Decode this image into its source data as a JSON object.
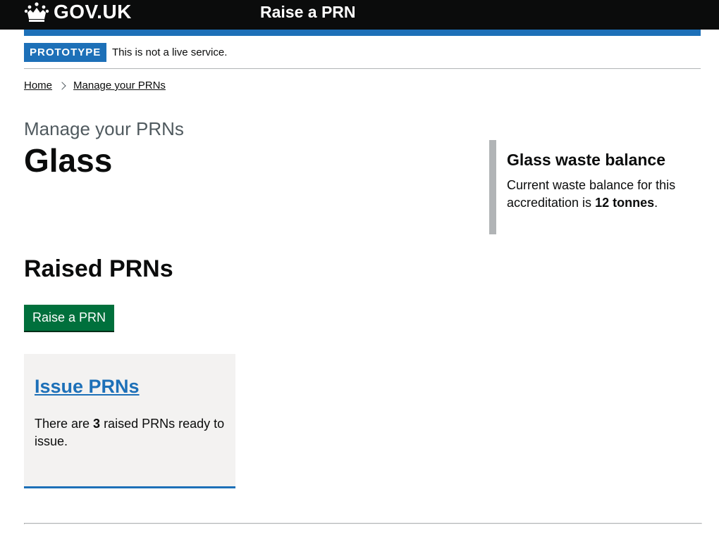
{
  "header": {
    "logo_text": "GOV.UK",
    "service_name": "Raise a PRN"
  },
  "phase_banner": {
    "tag": "PROTOTYPE",
    "text": "This is not a live service."
  },
  "breadcrumbs": [
    "Home",
    "Manage your PRNs"
  ],
  "page": {
    "caption": "Manage your PRNs",
    "title": "Glass"
  },
  "balance_panel": {
    "title": "Glass waste balance",
    "text_before": "Current waste balance for this accreditation is ",
    "amount": "12 tonnes",
    "text_after": "."
  },
  "raised_section": {
    "heading": "Raised PRNs",
    "button_label": "Raise a PRN"
  },
  "issue_card": {
    "title": "Issue PRNs",
    "text_before": "There are ",
    "count": "3",
    "text_after": " raised PRNs ready to issue."
  },
  "colors": {
    "header_bg": "#0b0c0c",
    "brand_blue": "#1d70b8",
    "button_green": "#00703c",
    "card_bg": "#f3f2f1"
  }
}
